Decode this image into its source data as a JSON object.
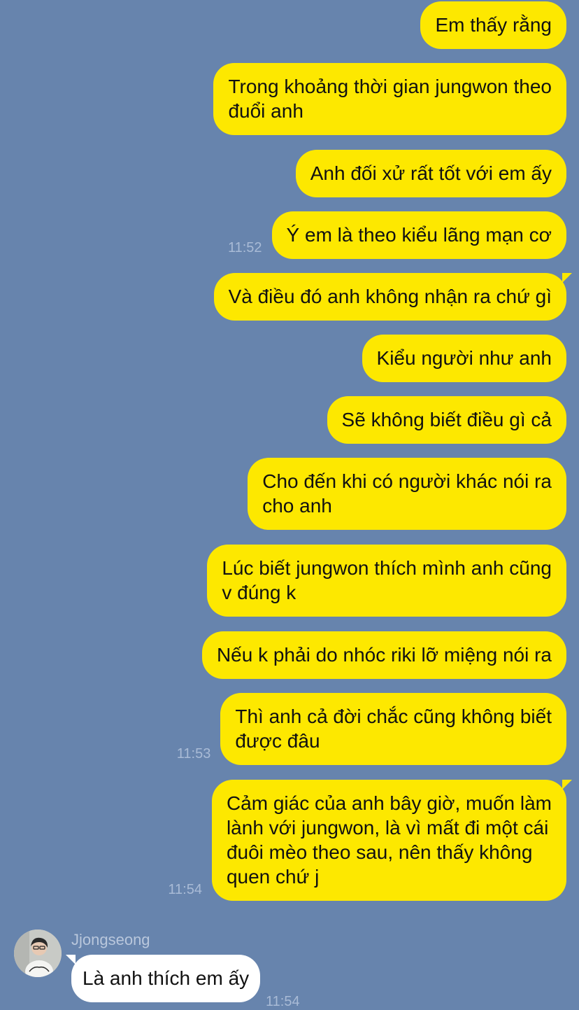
{
  "messages_out": [
    {
      "text": "Em thấy rằng",
      "time": ""
    },
    {
      "text": "Trong khoảng thời gian jungwon theo\nđuổi anh",
      "time": ""
    },
    {
      "text": "Anh đối xử rất tốt với em ấy",
      "time": ""
    },
    {
      "text": "Ý em là theo kiểu lãng mạn cơ",
      "time": "11:52"
    },
    {
      "text": "Và điều đó anh không nhận ra chứ gì",
      "time": ""
    },
    {
      "text": "Kiểu người như anh",
      "time": ""
    },
    {
      "text": "Sẽ không biết điều gì cả",
      "time": ""
    },
    {
      "text": "Cho đến khi có người khác nói ra\ncho anh",
      "time": ""
    },
    {
      "text": "Lúc biết jungwon thích mình anh cũng\nv đúng k",
      "time": ""
    },
    {
      "text": "Nếu k phải do nhóc riki lỡ miệng nói ra",
      "time": ""
    },
    {
      "text": "Thì anh cả đời chắc cũng không biết\nđược đâu",
      "time": "11:53"
    },
    {
      "text": "Cảm giác của anh bây giờ, muốn làm\nlành với jungwon, là vì mất đi một cái\nđuôi mèo theo sau, nên thấy không\nquen chứ j",
      "time": "11:54"
    }
  ],
  "incoming": {
    "sender": "Jjongseong",
    "text": "Là anh thích em ấy",
    "time": "11:54",
    "avatar_icon": "profile-photo"
  },
  "colors": {
    "background": "#6784ad",
    "outgoing_bubble": "#fde800",
    "incoming_bubble": "#ffffff",
    "timestamp": "#a9bbd6"
  }
}
